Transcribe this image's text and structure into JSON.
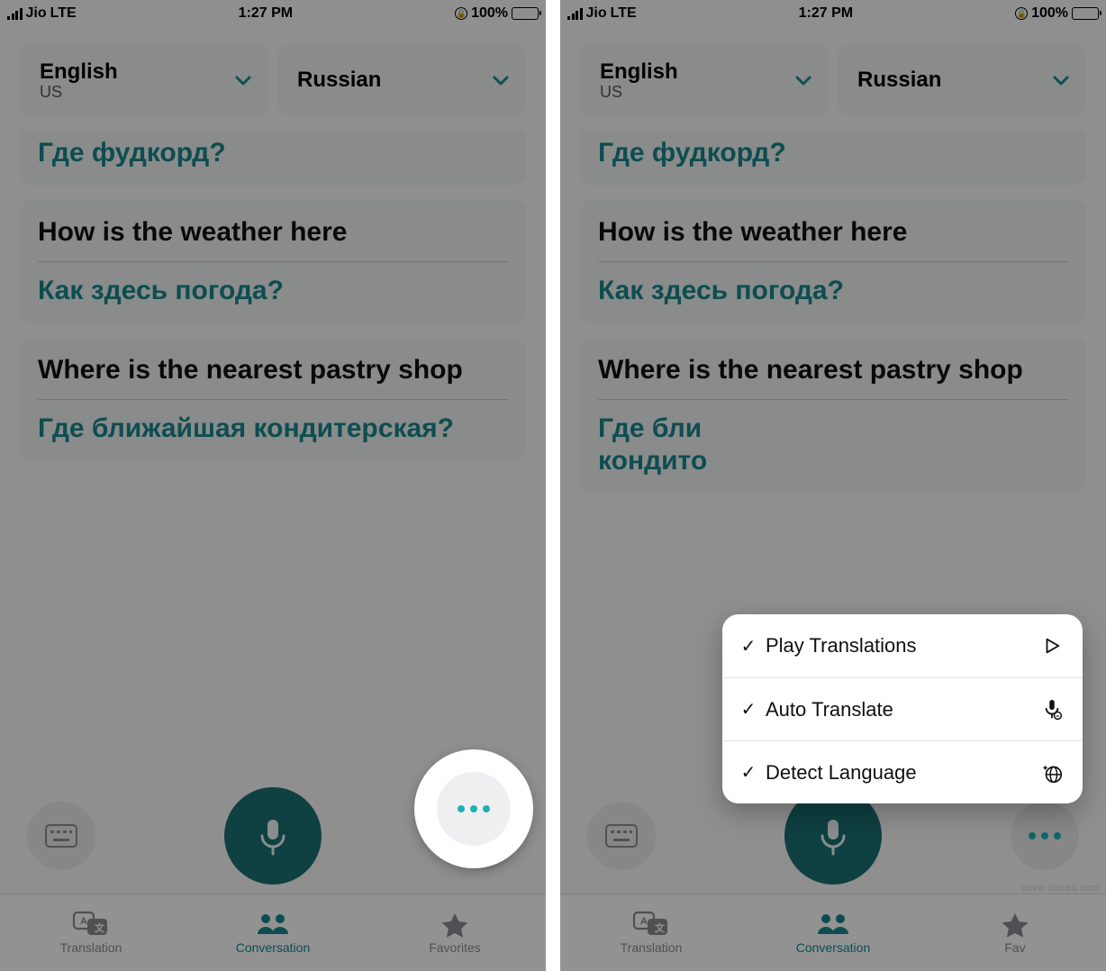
{
  "status": {
    "carrier": "Jio",
    "network": "LTE",
    "time": "1:27 PM",
    "battery_pct": "100%"
  },
  "langs": {
    "source": {
      "name": "English",
      "sub": "US"
    },
    "target": {
      "name": "Russian"
    }
  },
  "cards": [
    {
      "src": "",
      "tgt": "Где фудкорд?"
    },
    {
      "src": "How is the weather here",
      "tgt": "Как здесь погода?"
    },
    {
      "src": "Where is the nearest pastry shop",
      "tgt": "Где ближайшая кондитерская?"
    }
  ],
  "cards_right_last_tgt_visible": "Где бли\nкондито",
  "tabs": {
    "translation": "Translation",
    "conversation": "Conversation",
    "favorites": "Favorites"
  },
  "popover": {
    "items": [
      {
        "label": "Play Translations",
        "checked": true,
        "icon": "play"
      },
      {
        "label": "Auto Translate",
        "checked": true,
        "icon": "mic-auto"
      },
      {
        "label": "Detect Language",
        "checked": true,
        "icon": "globe"
      }
    ]
  },
  "right_tab_favorites_partial": "Fav",
  "watermark": "www.deuaq.com"
}
